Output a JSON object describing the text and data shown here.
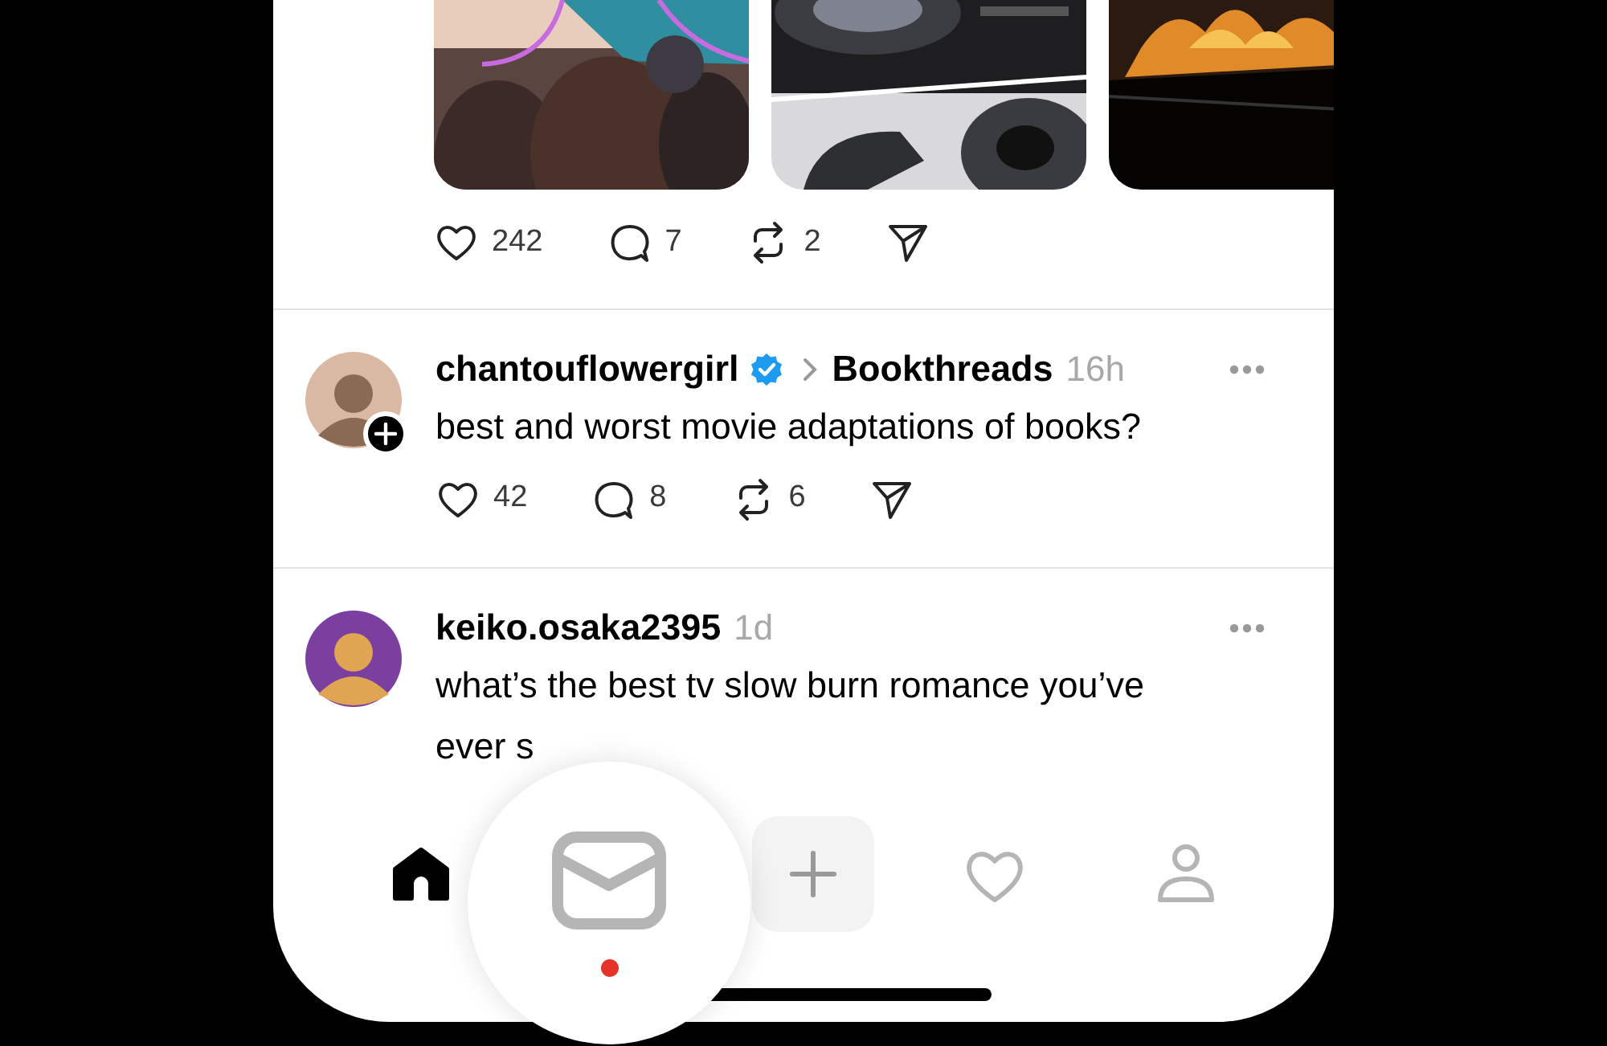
{
  "feed": [
    {
      "actions": {
        "likes": "242",
        "replies": "7",
        "reposts": "2"
      }
    },
    {
      "avatar": {
        "follow_badge": true
      },
      "username": "chantouflowergirl",
      "verified": true,
      "community": "Bookthreads",
      "time": "16h",
      "text": [
        "best and worst movie adaptations of books?"
      ],
      "actions": {
        "likes": "42",
        "replies": "8",
        "reposts": "6"
      }
    },
    {
      "avatar": {
        "follow_badge": false
      },
      "username": "keiko.osaka2395",
      "verified": false,
      "time": "1d",
      "text": [
        "what’s the best tv slow burn romance you’ve",
        "ever s"
      ]
    }
  ],
  "tab_bar": {
    "items": [
      {
        "kind": "home",
        "selected": true
      },
      {
        "kind": "messages",
        "selected": false,
        "unread": true
      },
      {
        "kind": "compose",
        "selected": false
      },
      {
        "kind": "activity",
        "selected": false
      },
      {
        "kind": "profile",
        "selected": false
      }
    ]
  }
}
